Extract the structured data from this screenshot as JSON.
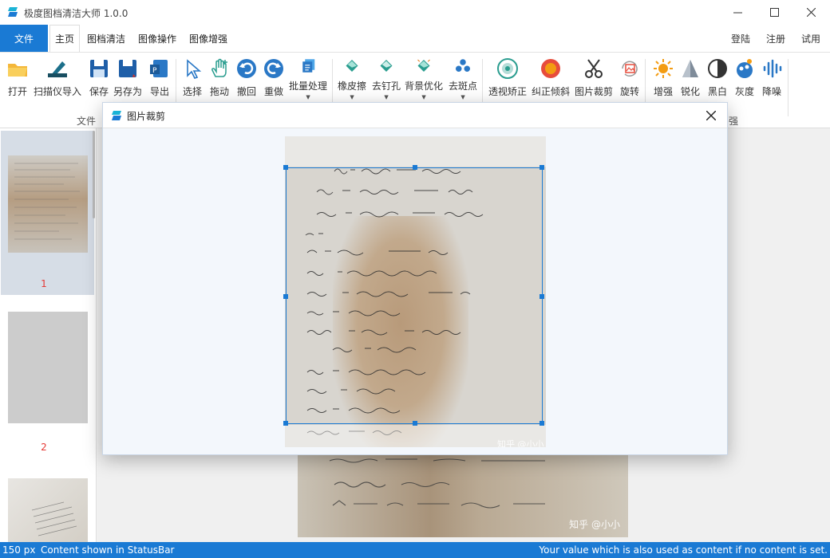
{
  "window": {
    "title": "极度图档清洁大师 1.0.0"
  },
  "menu": {
    "file": "文件",
    "tabs": [
      "主页",
      "图档清洁",
      "图像操作",
      "图像增强"
    ],
    "right": [
      "登陆",
      "注册",
      "试用"
    ]
  },
  "ribbon": {
    "buttons": [
      "打开",
      "扫描仪导入",
      "保存",
      "另存为",
      "导出",
      "选择",
      "拖动",
      "撤回",
      "重做",
      "批量处理",
      "橡皮擦",
      "去钉孔",
      "背景优化",
      "去斑点",
      "透视矫正",
      "纠正倾斜",
      "图片裁剪",
      "旋转",
      "增强",
      "锐化",
      "黑白",
      "灰度",
      "降噪"
    ],
    "group_file": "文件",
    "group_enhance": "强"
  },
  "thumbs": [
    {
      "num": "1"
    },
    {
      "num": "2"
    }
  ],
  "dialog": {
    "title": "图片裁剪",
    "watermark": "知乎 @小小"
  },
  "background": {
    "watermark": "知乎 @小小"
  },
  "status": {
    "left": "150 px",
    "middle": "Content shown in StatusBar",
    "right": "Your value which is also used as content if no content is set."
  },
  "colors": {
    "accent": "#1a7ad4",
    "page_number": "#e53935"
  }
}
